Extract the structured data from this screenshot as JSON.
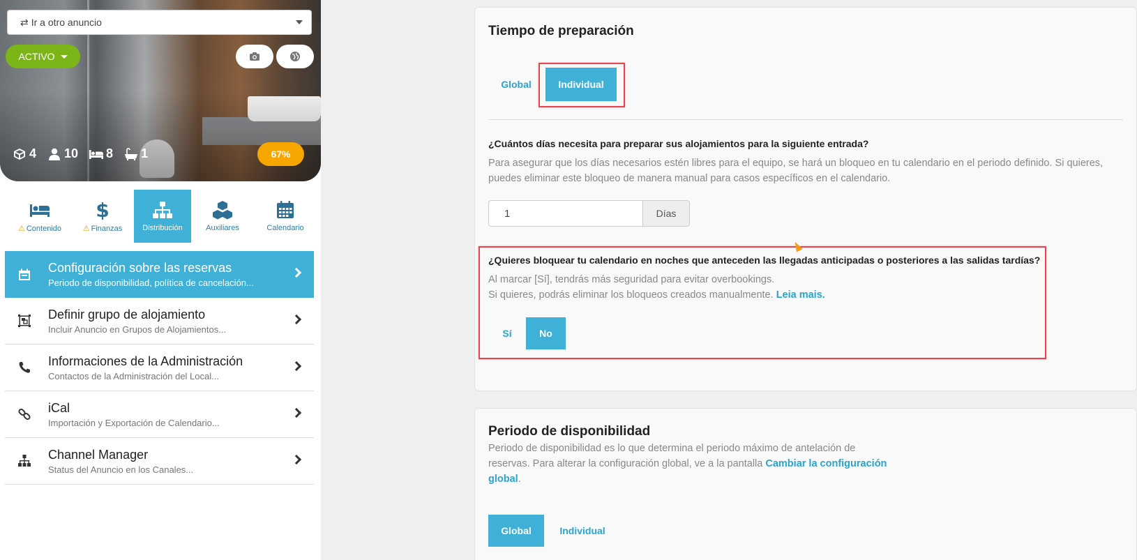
{
  "left_panel": {
    "ad_selector": {
      "label": "Ir a otro anuncio"
    },
    "status": {
      "label": "ACTIVO",
      "color": "#7cb518"
    },
    "photo_button_icon": "camera-icon",
    "globe_button_icon": "globe-icon",
    "stats": {
      "units": "4",
      "guests": "10",
      "beds": "8",
      "baths": "1"
    },
    "completion": {
      "label": "67%",
      "value": 67
    },
    "tabs": [
      {
        "label": "Contenido",
        "icon": "bed-icon",
        "warning": true
      },
      {
        "label": "Finanzas",
        "icon": "dollar-icon",
        "warning": true
      },
      {
        "label": "Distribución",
        "icon": "sitemap-icon",
        "active": true
      },
      {
        "label": "Auxiliares",
        "icon": "cubes-icon"
      },
      {
        "label": "Calendario",
        "icon": "calendar-icon"
      }
    ],
    "menu": [
      {
        "title": "Configuración sobre las reservas",
        "subtitle": "Periodo de disponibilidad, política de cancelación...",
        "icon": "calendar-icon",
        "active": true
      },
      {
        "title": "Definir grupo de alojamiento",
        "subtitle": "Incluir Anuncio en Grupos de Alojamientos...",
        "icon": "group-icon"
      },
      {
        "title": "Informaciones de la Administración",
        "subtitle": "Contactos de la Administración del Local...",
        "icon": "phone-icon"
      },
      {
        "title": "iCal",
        "subtitle": "Importación y Exportación de Calendario...",
        "icon": "link-icon"
      },
      {
        "title": "Channel Manager",
        "subtitle": "Status del Anuncio en los Canales...",
        "icon": "sitemap-icon"
      }
    ]
  },
  "prep_card": {
    "title": "Tiempo de preparación",
    "seg_global": "Global",
    "seg_individual": "Individual",
    "question1": "¿Cuántos días necesita para preparar sus alojamientos para la siguiente entrada?",
    "desc1_line1": "Para asegurar que los días necesarios estén libres para el equipo, se hará un bloqueo en tu calendario en el periodo definido. Si quieres,",
    "desc1_line2": "puedes eliminar este bloqueo de manera manual para casos específicos en el calendario.",
    "days_value": "1",
    "days_unit": "Días",
    "question2": "¿Quieres bloquear tu calendario en noches que anteceden las llegadas anticipadas o posteriores a las salidas tardías?",
    "desc2_line1": "Al marcar [Sí], tendrás más seguridad para evitar overbookings.",
    "desc2_line2": "Si quieres, podrás eliminar los bloqueos creados manualmente.",
    "desc2_link": "Leia mais.",
    "opt_yes": "Sí",
    "opt_no": "No"
  },
  "availability_card": {
    "title": "Periodo de disponibilidad",
    "desc_line1": "Periodo de disponibilidad es lo que determina el periodo máximo de antelación de",
    "desc_line2": "reservas. Para alterar la configuración global, ve a la pantalla",
    "desc_link_part1": "Cambiar la configuración",
    "desc_link_part2": "global",
    "desc_end": ".",
    "seg_global": "Global",
    "seg_individual": "Individual"
  },
  "colors": {
    "accent": "#3fb0d8",
    "highlight": "#e64650",
    "warning": "#f7a600"
  }
}
